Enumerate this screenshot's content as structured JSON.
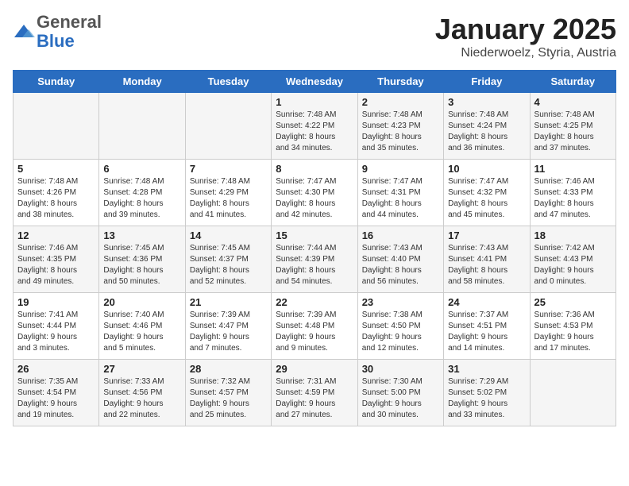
{
  "header": {
    "logo_general": "General",
    "logo_blue": "Blue",
    "month_title": "January 2025",
    "location": "Niederwoelz, Styria, Austria"
  },
  "days_of_week": [
    "Sunday",
    "Monday",
    "Tuesday",
    "Wednesday",
    "Thursday",
    "Friday",
    "Saturday"
  ],
  "weeks": [
    [
      {
        "day": "",
        "content": ""
      },
      {
        "day": "",
        "content": ""
      },
      {
        "day": "",
        "content": ""
      },
      {
        "day": "1",
        "content": "Sunrise: 7:48 AM\nSunset: 4:22 PM\nDaylight: 8 hours\nand 34 minutes."
      },
      {
        "day": "2",
        "content": "Sunrise: 7:48 AM\nSunset: 4:23 PM\nDaylight: 8 hours\nand 35 minutes."
      },
      {
        "day": "3",
        "content": "Sunrise: 7:48 AM\nSunset: 4:24 PM\nDaylight: 8 hours\nand 36 minutes."
      },
      {
        "day": "4",
        "content": "Sunrise: 7:48 AM\nSunset: 4:25 PM\nDaylight: 8 hours\nand 37 minutes."
      }
    ],
    [
      {
        "day": "5",
        "content": "Sunrise: 7:48 AM\nSunset: 4:26 PM\nDaylight: 8 hours\nand 38 minutes."
      },
      {
        "day": "6",
        "content": "Sunrise: 7:48 AM\nSunset: 4:28 PM\nDaylight: 8 hours\nand 39 minutes."
      },
      {
        "day": "7",
        "content": "Sunrise: 7:48 AM\nSunset: 4:29 PM\nDaylight: 8 hours\nand 41 minutes."
      },
      {
        "day": "8",
        "content": "Sunrise: 7:47 AM\nSunset: 4:30 PM\nDaylight: 8 hours\nand 42 minutes."
      },
      {
        "day": "9",
        "content": "Sunrise: 7:47 AM\nSunset: 4:31 PM\nDaylight: 8 hours\nand 44 minutes."
      },
      {
        "day": "10",
        "content": "Sunrise: 7:47 AM\nSunset: 4:32 PM\nDaylight: 8 hours\nand 45 minutes."
      },
      {
        "day": "11",
        "content": "Sunrise: 7:46 AM\nSunset: 4:33 PM\nDaylight: 8 hours\nand 47 minutes."
      }
    ],
    [
      {
        "day": "12",
        "content": "Sunrise: 7:46 AM\nSunset: 4:35 PM\nDaylight: 8 hours\nand 49 minutes."
      },
      {
        "day": "13",
        "content": "Sunrise: 7:45 AM\nSunset: 4:36 PM\nDaylight: 8 hours\nand 50 minutes."
      },
      {
        "day": "14",
        "content": "Sunrise: 7:45 AM\nSunset: 4:37 PM\nDaylight: 8 hours\nand 52 minutes."
      },
      {
        "day": "15",
        "content": "Sunrise: 7:44 AM\nSunset: 4:39 PM\nDaylight: 8 hours\nand 54 minutes."
      },
      {
        "day": "16",
        "content": "Sunrise: 7:43 AM\nSunset: 4:40 PM\nDaylight: 8 hours\nand 56 minutes."
      },
      {
        "day": "17",
        "content": "Sunrise: 7:43 AM\nSunset: 4:41 PM\nDaylight: 8 hours\nand 58 minutes."
      },
      {
        "day": "18",
        "content": "Sunrise: 7:42 AM\nSunset: 4:43 PM\nDaylight: 9 hours\nand 0 minutes."
      }
    ],
    [
      {
        "day": "19",
        "content": "Sunrise: 7:41 AM\nSunset: 4:44 PM\nDaylight: 9 hours\nand 3 minutes."
      },
      {
        "day": "20",
        "content": "Sunrise: 7:40 AM\nSunset: 4:46 PM\nDaylight: 9 hours\nand 5 minutes."
      },
      {
        "day": "21",
        "content": "Sunrise: 7:39 AM\nSunset: 4:47 PM\nDaylight: 9 hours\nand 7 minutes."
      },
      {
        "day": "22",
        "content": "Sunrise: 7:39 AM\nSunset: 4:48 PM\nDaylight: 9 hours\nand 9 minutes."
      },
      {
        "day": "23",
        "content": "Sunrise: 7:38 AM\nSunset: 4:50 PM\nDaylight: 9 hours\nand 12 minutes."
      },
      {
        "day": "24",
        "content": "Sunrise: 7:37 AM\nSunset: 4:51 PM\nDaylight: 9 hours\nand 14 minutes."
      },
      {
        "day": "25",
        "content": "Sunrise: 7:36 AM\nSunset: 4:53 PM\nDaylight: 9 hours\nand 17 minutes."
      }
    ],
    [
      {
        "day": "26",
        "content": "Sunrise: 7:35 AM\nSunset: 4:54 PM\nDaylight: 9 hours\nand 19 minutes."
      },
      {
        "day": "27",
        "content": "Sunrise: 7:33 AM\nSunset: 4:56 PM\nDaylight: 9 hours\nand 22 minutes."
      },
      {
        "day": "28",
        "content": "Sunrise: 7:32 AM\nSunset: 4:57 PM\nDaylight: 9 hours\nand 25 minutes."
      },
      {
        "day": "29",
        "content": "Sunrise: 7:31 AM\nSunset: 4:59 PM\nDaylight: 9 hours\nand 27 minutes."
      },
      {
        "day": "30",
        "content": "Sunrise: 7:30 AM\nSunset: 5:00 PM\nDaylight: 9 hours\nand 30 minutes."
      },
      {
        "day": "31",
        "content": "Sunrise: 7:29 AM\nSunset: 5:02 PM\nDaylight: 9 hours\nand 33 minutes."
      },
      {
        "day": "",
        "content": ""
      }
    ]
  ]
}
